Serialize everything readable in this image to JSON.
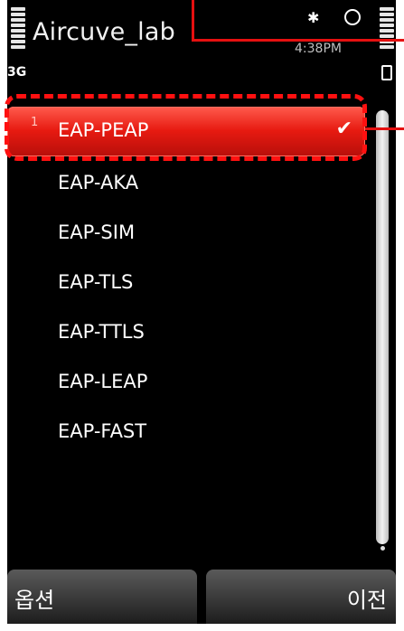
{
  "status": {
    "title": "Aircuve_lab",
    "network": "3G",
    "time": "4:38PM",
    "icons": [
      "signal-icon",
      "bluetooth-icon",
      "alarm-icon",
      "battery-icon"
    ]
  },
  "list": {
    "selected_index": 1,
    "items": [
      {
        "label": "EAP-PEAP",
        "number": "1",
        "checked": true
      },
      {
        "label": "EAP-AKA"
      },
      {
        "label": "EAP-SIM"
      },
      {
        "label": "EAP-TLS"
      },
      {
        "label": "EAP-TTLS"
      },
      {
        "label": "EAP-LEAP"
      },
      {
        "label": "EAP-FAST"
      }
    ]
  },
  "softkeys": {
    "left": "옵션",
    "right": "이전"
  },
  "colors": {
    "selection": "#e71a11",
    "annotation": "#ff1010"
  }
}
